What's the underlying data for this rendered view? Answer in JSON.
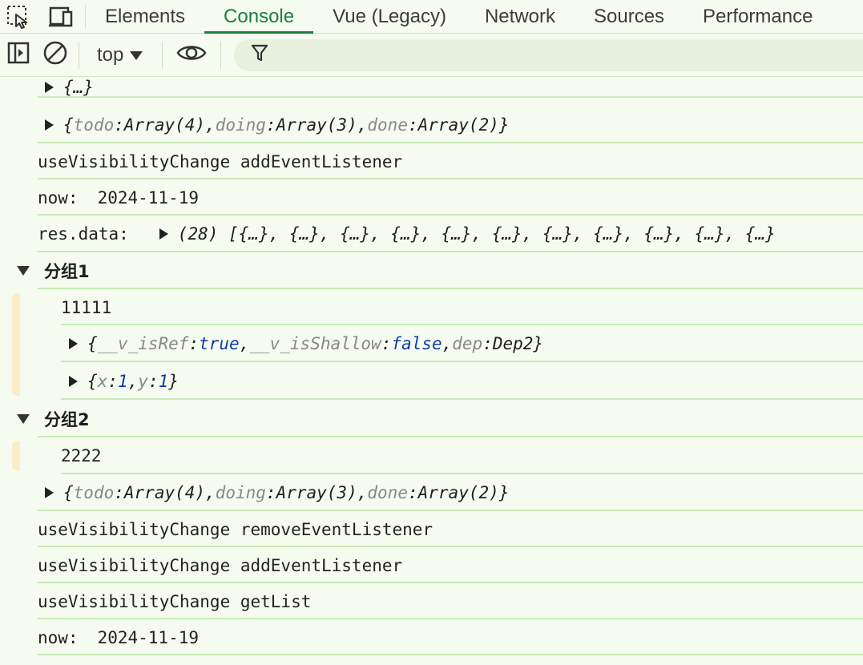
{
  "tabs": [
    {
      "label": "Elements",
      "active": false
    },
    {
      "label": "Console",
      "active": true
    },
    {
      "label": "Vue (Legacy)",
      "active": false
    },
    {
      "label": "Network",
      "active": false
    },
    {
      "label": "Sources",
      "active": false
    },
    {
      "label": "Performance",
      "active": false
    }
  ],
  "toolbar": {
    "context": "top"
  },
  "colors": {
    "accent": "#17803d",
    "background": "#f6fbf0",
    "row_divider": "#c7ebb9",
    "value_blue": "#0e3ba6",
    "key_gray": "#888888",
    "group_gutter": "#fbedc6"
  },
  "console": {
    "row0": {
      "text": "{…}"
    },
    "row1": {
      "open": "{",
      "k1": "todo",
      "v1": "Array(4)",
      "k2": "doing",
      "v2": "Array(3)",
      "k3": "done",
      "v3": "Array(2)",
      "close": "}"
    },
    "row2": {
      "text": "useVisibilityChange addEventListener"
    },
    "row3": {
      "label": "now:",
      "value": "2024-11-19"
    },
    "row4": {
      "label": "res.data:",
      "value": "(28) [{…}, {…}, {…}, {…}, {…}, {…}, {…}, {…}, {…}, {…}, {…}"
    },
    "group1": {
      "title": "分组1"
    },
    "g1row1": {
      "text": "11111"
    },
    "g1row2": {
      "open": "{",
      "k1": "__v_isRef",
      "v1": "true",
      "k2": "__v_isShallow",
      "v2": "false",
      "k3": "dep",
      "v3": "Dep2",
      "close": "}"
    },
    "g1row3": {
      "open": "{",
      "k1": "x",
      "v1": "1",
      "k2": "y",
      "v2": "1",
      "close": "}"
    },
    "group2": {
      "title": "分组2"
    },
    "g2row1": {
      "text": "2222"
    },
    "row5": {
      "open": "{",
      "k1": "todo",
      "v1": "Array(4)",
      "k2": "doing",
      "v2": "Array(3)",
      "k3": "done",
      "v3": "Array(2)",
      "close": "}"
    },
    "row6": {
      "text": "useVisibilityChange removeEventListener"
    },
    "row7": {
      "text": "useVisibilityChange addEventListener"
    },
    "row8": {
      "text": "useVisibilityChange getList"
    },
    "row9": {
      "label": "now:",
      "value": "2024-11-19"
    }
  }
}
